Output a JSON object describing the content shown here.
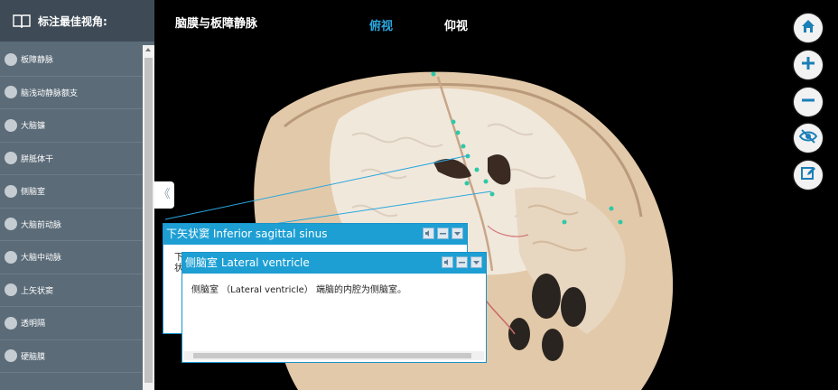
{
  "sidebar": {
    "title": "标注最佳视角:",
    "items": [
      {
        "label": "板障静脉"
      },
      {
        "label": "脑浅动静脉额支"
      },
      {
        "label": "大脑镰"
      },
      {
        "label": "胼胝体干"
      },
      {
        "label": "侧脑室"
      },
      {
        "label": "大脑前动脉"
      },
      {
        "label": "大脑中动脉"
      },
      {
        "label": "上矢状窦"
      },
      {
        "label": "透明隔"
      },
      {
        "label": "硬脑膜"
      }
    ]
  },
  "header": {
    "title": "脑膜与板障静脉",
    "tab_top": "俯视",
    "tab_bottom": "仰视"
  },
  "panels": {
    "back": {
      "title": "下矢状窦 Inferior sagittal sinus",
      "body_fragment_1": "下",
      "body_fragment_2": "状"
    },
    "front": {
      "title": "侧脑室 Lateral ventricle",
      "body": "侧脑室 （Lateral ventricle） 端脑的内腔为侧脑室。"
    }
  },
  "tools": [
    "home-icon",
    "zoom-in-icon",
    "zoom-out-icon",
    "hide-icon",
    "edit-icon"
  ],
  "colors": {
    "sidebar_bg": "#5b6b78",
    "sidebar_header": "#3e4b56",
    "accent": "#2aa7df",
    "panel_header": "#1d9fd4",
    "marker": "#2cc9a8"
  }
}
